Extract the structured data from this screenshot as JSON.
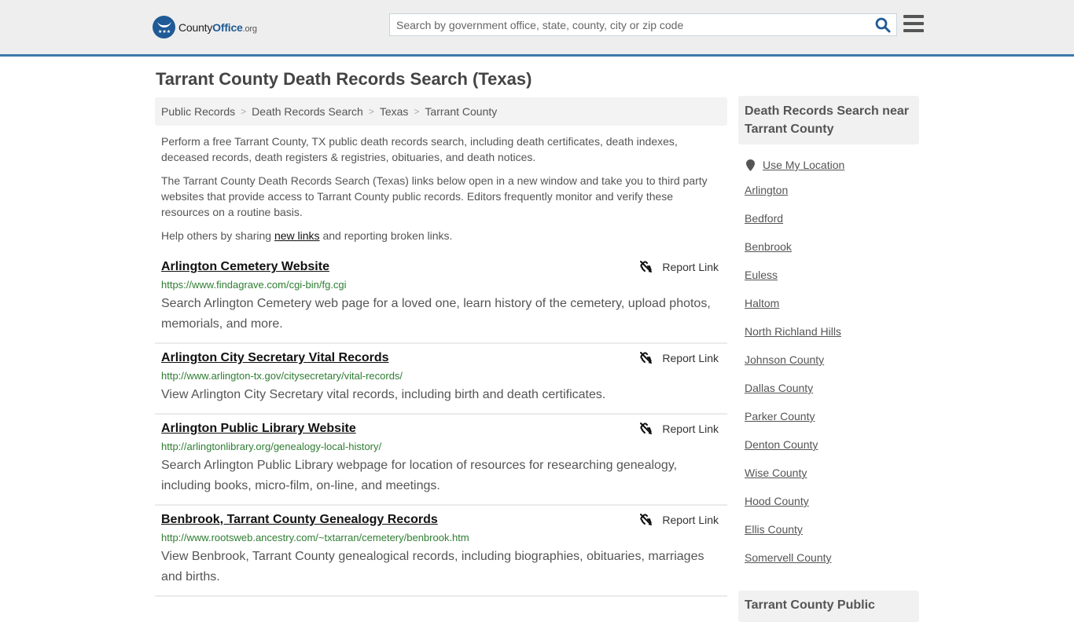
{
  "header": {
    "logo": {
      "name_part1": "County",
      "name_part2": "Office",
      "tld": ".org"
    },
    "search": {
      "placeholder": "Search by government office, state, county, city or zip code",
      "value": ""
    },
    "colors": {
      "brand": "#1f5a96",
      "accent_border": "#3d79ab"
    }
  },
  "page": {
    "title": "Tarrant County Death Records Search (Texas)"
  },
  "breadcrumb": [
    {
      "label": "Public Records"
    },
    {
      "label": "Death Records Search"
    },
    {
      "label": "Texas"
    },
    {
      "label": "Tarrant County"
    }
  ],
  "breadcrumb_separator": ">",
  "intro": {
    "p1": "Perform a free Tarrant County, TX public death records search, including death certificates, death indexes, deceased records, death registers & registries, obituaries, and death notices.",
    "p2": "The Tarrant County Death Records Search (Texas) links below open in a new window and take you to third party websites that provide access to Tarrant County public records. Editors frequently monitor and verify these resources on a routine basis.",
    "p3_before": "Help others by sharing ",
    "p3_link": "new links",
    "p3_after": " and reporting broken links."
  },
  "results": [
    {
      "title": "Arlington Cemetery Website",
      "url": "https://www.findagrave.com/cgi-bin/fg.cgi",
      "description": "Search Arlington Cemetery web page for a loved one, learn history of the cemetery, upload photos, memorials, and more.",
      "report_label": "Report Link"
    },
    {
      "title": "Arlington City Secretary Vital Records",
      "url": "http://www.arlington-tx.gov/citysecretary/vital-records/",
      "description": "View Arlington City Secretary vital records, including birth and death certificates.",
      "report_label": "Report Link"
    },
    {
      "title": "Arlington Public Library Website",
      "url": "http://arlingtonlibrary.org/genealogy-local-history/",
      "description": "Search Arlington Public Library webpage for location of resources for researching genealogy, including books, micro-film, on-line, and meetings.",
      "report_label": "Report Link"
    },
    {
      "title": "Benbrook, Tarrant County Genealogy Records",
      "url": "http://www.rootsweb.ancestry.com/~txtarran/cemetery/benbrook.htm",
      "description": "View Benbrook, Tarrant County genealogical records, including biographies, obituaries, marriages and births.",
      "report_label": "Report Link"
    }
  ],
  "sidebar": {
    "header": "Death Records Search near Tarrant County",
    "use_location": "Use My Location",
    "links": [
      "Arlington",
      "Bedford",
      "Benbrook",
      "Euless",
      "Haltom",
      "North Richland Hills",
      "Johnson County",
      "Dallas County",
      "Parker County",
      "Denton County",
      "Wise County",
      "Hood County",
      "Ellis County",
      "Somervell County"
    ],
    "header2": "Tarrant County Public"
  }
}
